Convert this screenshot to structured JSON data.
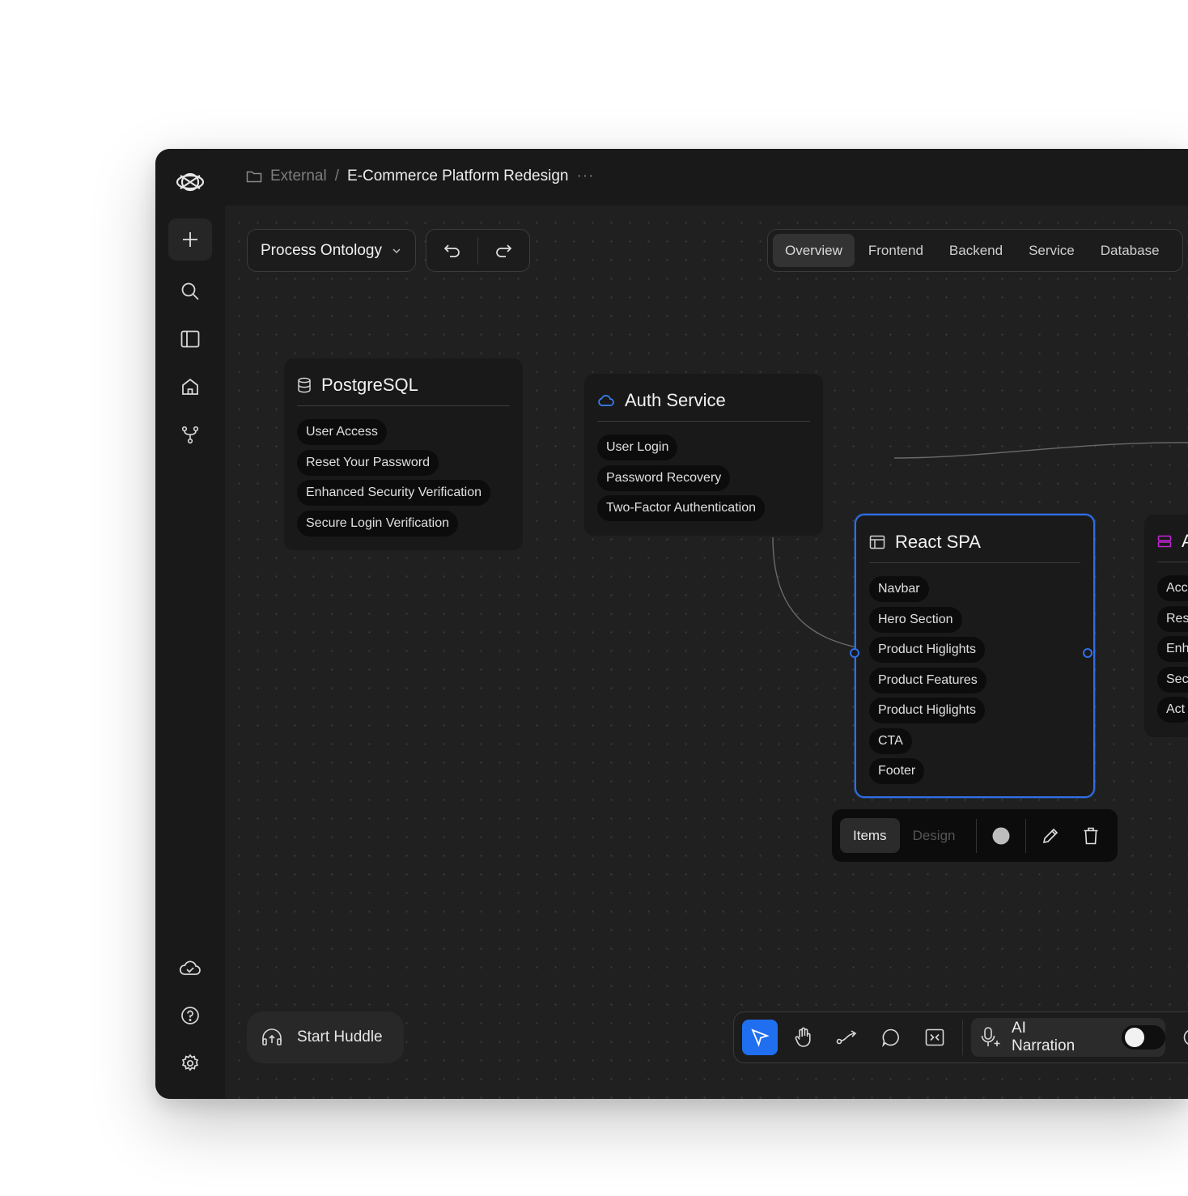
{
  "breadcrumb": {
    "parent": "External",
    "separator": "/",
    "title": "E-Commerce Platform Redesign",
    "more": "···"
  },
  "toolbar": {
    "dropdown_label": "Process Ontology"
  },
  "tabs": [
    {
      "label": "Overview",
      "active": true
    },
    {
      "label": "Frontend",
      "active": false
    },
    {
      "label": "Backend",
      "active": false
    },
    {
      "label": "Service",
      "active": false
    },
    {
      "label": "Database",
      "active": false
    }
  ],
  "nodes": {
    "postgresql": {
      "title": "PostgreSQL",
      "icon": "database-icon",
      "items": [
        "User Access",
        "Reset Your Password",
        "Enhanced Security Verification",
        "Secure Login Verification"
      ]
    },
    "auth": {
      "title": "Auth Service",
      "icon": "cloud-icon",
      "accent": "#3b82f6",
      "items": [
        "User Login",
        "Password Recovery",
        "Two-Factor Authentication"
      ]
    },
    "react": {
      "title": "React SPA",
      "icon": "layout-icon",
      "selected": true,
      "accent": "#2f6fe6",
      "items": [
        "Navbar",
        "Hero Section",
        "Product Higlights",
        "Product Features",
        "Product Higlights",
        "CTA",
        "Footer"
      ]
    },
    "partial": {
      "title": "A",
      "icon": "server-icon",
      "accent": "#c026d3",
      "items": [
        "Acc",
        "Res",
        "Enh",
        "Sec",
        "Act"
      ]
    }
  },
  "node_toolbar": {
    "items_label": "Items",
    "design_label": "Design",
    "color": "#bdbdbd"
  },
  "huddle": {
    "label": "Start Huddle"
  },
  "bottom_toolbar": {
    "active_tool": "select",
    "narration_label": "AI Narration",
    "narration_enabled": false
  }
}
